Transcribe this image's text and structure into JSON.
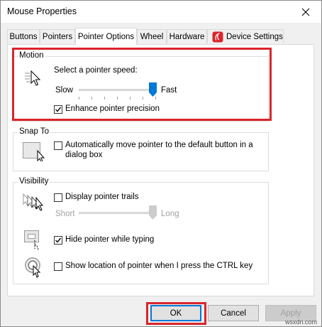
{
  "window": {
    "title": "Mouse Properties"
  },
  "tabs": [
    {
      "label": "Buttons"
    },
    {
      "label": "Pointers"
    },
    {
      "label": "Pointer Options"
    },
    {
      "label": "Wheel"
    },
    {
      "label": "Hardware"
    },
    {
      "label": "Device Settings"
    }
  ],
  "active_tab": "Pointer Options",
  "motion": {
    "legend": "Motion",
    "speed_label": "Select a pointer speed:",
    "slow_label": "Slow",
    "fast_label": "Fast",
    "speed_level": 1.0,
    "enhance_label": "Enhance pointer precision",
    "enhance_checked": true
  },
  "snap_to": {
    "legend": "Snap To",
    "auto_move_label_line1": "Automatically move pointer to the default button in a",
    "auto_move_label_line2": "dialog box",
    "auto_move_checked": false
  },
  "visibility": {
    "legend": "Visibility",
    "trails_label": "Display pointer trails",
    "trails_checked": false,
    "short_label": "Short",
    "long_label": "Long",
    "trail_level": 1.0,
    "hide_typing_label": "Hide pointer while typing",
    "hide_typing_checked": true,
    "ctrl_label": "Show location of pointer when I press the CTRL key",
    "ctrl_checked": false
  },
  "buttons": {
    "ok": "OK",
    "cancel": "Cancel",
    "apply": "Apply"
  },
  "watermark": "wsxdn.com",
  "colors": {
    "accent": "#0078d7",
    "highlight": "#d9252b",
    "device_icon": "#d9252b"
  },
  "icons": {
    "close": "close-icon",
    "device": "device-settings-icon",
    "motion": "pointer-speed-icon",
    "snap": "snap-to-button-icon",
    "trails": "pointer-trails-icon",
    "hide": "hide-pointer-icon",
    "ctrl": "locate-pointer-icon"
  }
}
